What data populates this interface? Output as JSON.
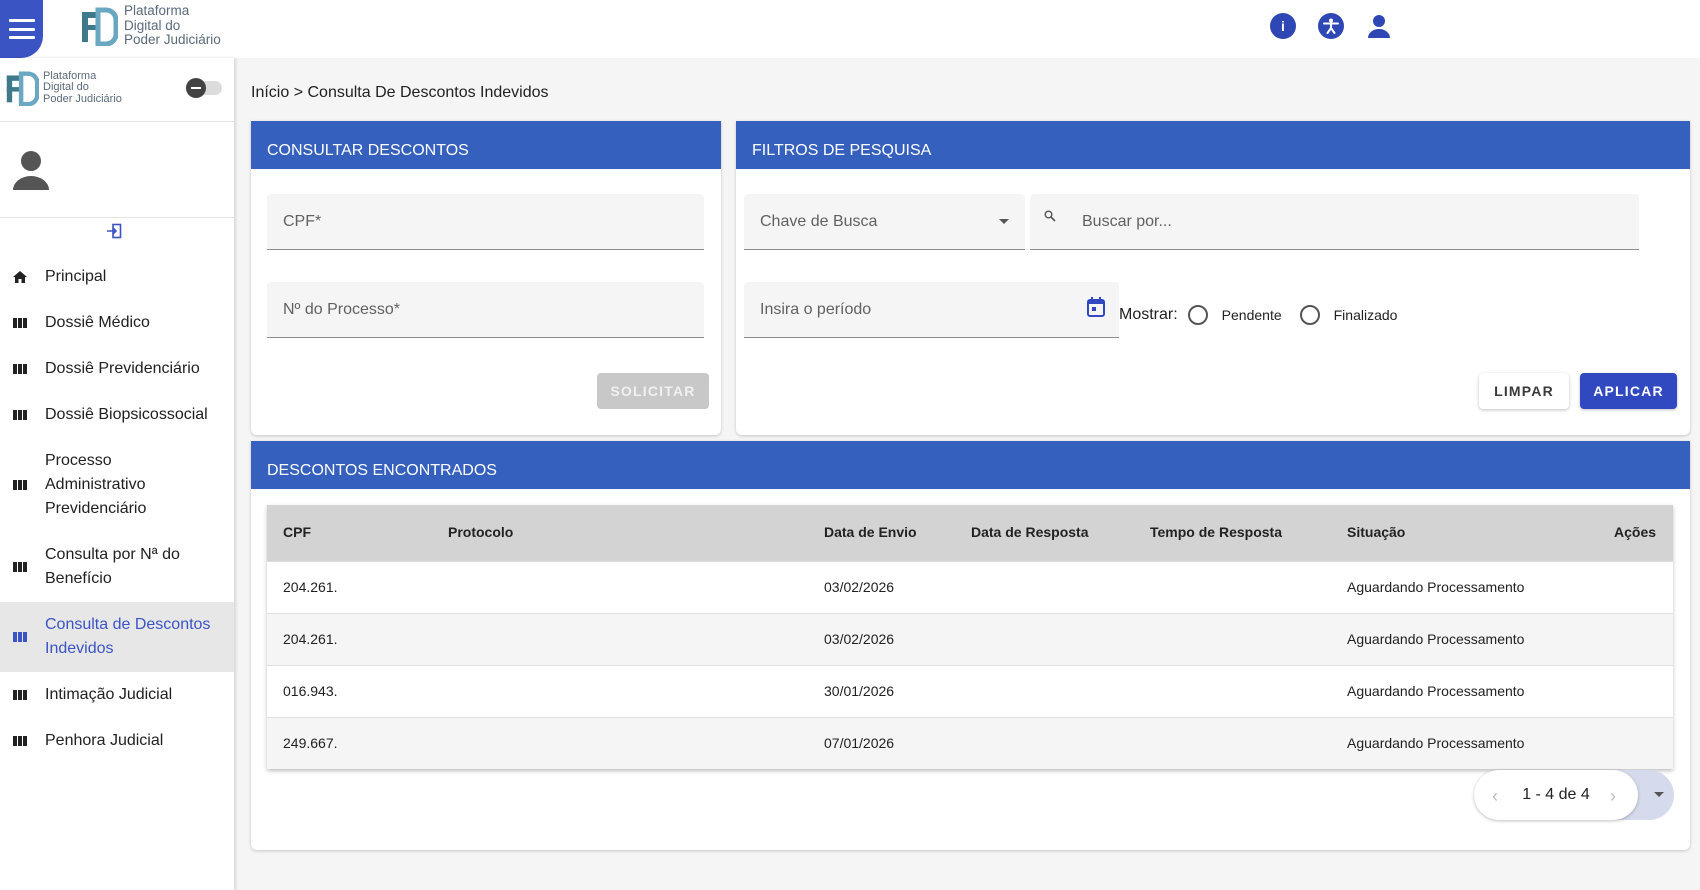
{
  "app": {
    "logo_text": [
      "Plataforma",
      "Digital do",
      "Poder Judiciário"
    ]
  },
  "breadcrumb": {
    "home": "Início",
    "separator": ">",
    "current": "Consulta De Descontos Indevidos"
  },
  "sidebar": {
    "items": [
      {
        "label": "Principal",
        "icon": "home-icon"
      },
      {
        "label": "Dossiê Médico",
        "icon": "folder-icon"
      },
      {
        "label": "Dossiê Previdenciário",
        "icon": "folder-icon"
      },
      {
        "label": "Dossiê Biopsicossocial",
        "icon": "folder-icon"
      },
      {
        "label": "Processo Administrativo Previdenciário",
        "icon": "folder-icon"
      },
      {
        "label": "Consulta por Nª do Benefício",
        "icon": "folder-icon"
      },
      {
        "label": "Consulta de Descontos Indevidos",
        "icon": "folder-icon",
        "active": true
      },
      {
        "label": "Intimação Judicial",
        "icon": "folder-icon"
      },
      {
        "label": "Penhora Judicial",
        "icon": "folder-icon"
      }
    ]
  },
  "consultar": {
    "title": "CONSULTAR DESCONTOS",
    "cpf_label": "CPF*",
    "processo_label": "Nº do Processo*",
    "solicitar": "SOLICITAR"
  },
  "filtros": {
    "title": "FILTROS DE PESQUISA",
    "chave_label": "Chave de Busca",
    "buscar_placeholder": "Buscar por...",
    "periodo_label": "Insira o período",
    "mostrar_label": "Mostrar:",
    "opt_pendente": "Pendente",
    "opt_finalizado": "Finalizado",
    "limpar": "LIMPAR",
    "aplicar": "APLICAR"
  },
  "resultados": {
    "title": "DESCONTOS ENCONTRADOS",
    "columns": {
      "cpf": "CPF",
      "protocolo": "Protocolo",
      "data_envio": "Data de Envio",
      "data_resposta": "Data de Resposta",
      "tempo_resposta": "Tempo de Resposta",
      "situacao": "Situação",
      "acoes": "Ações"
    },
    "rows": [
      {
        "cpf": "204.261.",
        "protocolo": "",
        "data_envio": "03/02/2026",
        "data_resposta": "",
        "tempo_resposta": "",
        "situacao": "Aguardando Processamento"
      },
      {
        "cpf": "204.261.",
        "protocolo": "",
        "data_envio": "03/02/2026",
        "data_resposta": "",
        "tempo_resposta": "",
        "situacao": "Aguardando Processamento"
      },
      {
        "cpf": "016.943.",
        "protocolo": "",
        "data_envio": "30/01/2026",
        "data_resposta": "",
        "tempo_resposta": "",
        "situacao": "Aguardando Processamento"
      },
      {
        "cpf": "249.667.",
        "protocolo": "",
        "data_envio": "07/01/2026",
        "data_resposta": "",
        "tempo_resposta": "",
        "situacao": "Aguardando Processamento"
      }
    ],
    "pagination": "1 - 4 de 4"
  },
  "colors": {
    "primary": "#3049c0",
    "header_blue": "#3660bd",
    "active_text": "#3b54c4"
  }
}
